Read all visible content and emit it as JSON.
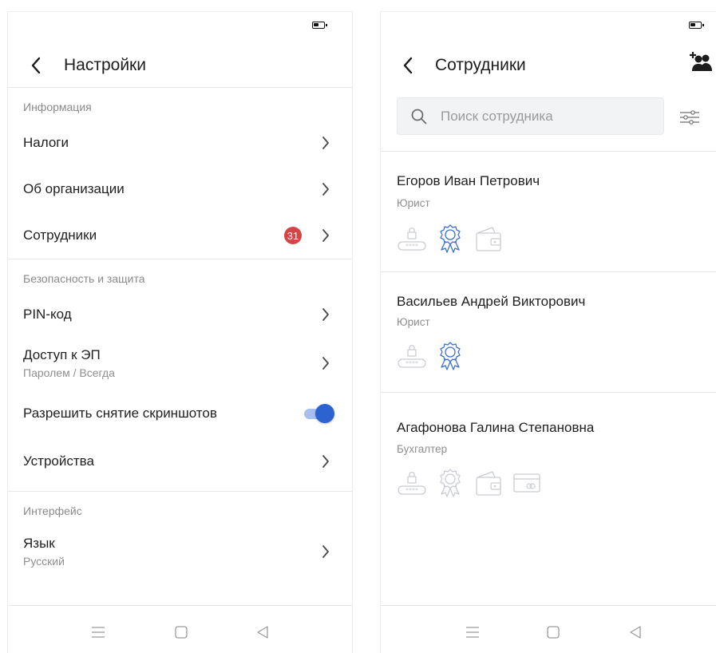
{
  "settings_screen": {
    "title": "Настройки",
    "sections": [
      {
        "header": "Информация",
        "items": [
          {
            "label": "Налоги"
          },
          {
            "label": "Об организации"
          },
          {
            "label": "Сотрудники",
            "badge": "31"
          }
        ]
      },
      {
        "header": "Безопасность и защита",
        "items": [
          {
            "label": "PIN-код"
          },
          {
            "label": "Доступ к ЭП",
            "sub": "Паролем / Всегда"
          },
          {
            "label": "Разрешить снятие скриншотов",
            "toggle": true
          },
          {
            "label": "Устройства"
          }
        ]
      },
      {
        "header": "Интерфейс",
        "items": [
          {
            "label": "Язык",
            "sub": "Русский"
          }
        ]
      }
    ]
  },
  "employees_screen": {
    "title": "Сотрудники",
    "search_placeholder": "Поиск сотрудника",
    "employees": [
      {
        "name": "Егоров Иван Петрович",
        "role": "Юрист",
        "icons": [
          "pin-lock-icon",
          "certificate-icon",
          "wallet-icon"
        ]
      },
      {
        "name": "Васильев Андрей Викторович",
        "role": "Юрист",
        "icons": [
          "pin-lock-icon",
          "certificate-icon"
        ]
      },
      {
        "name": "Агафонова Галина Степановна",
        "role": "Бухгалтер",
        "icons": [
          "pin-lock-icon",
          "certificate-icon",
          "wallet-icon",
          "card-icon"
        ]
      }
    ]
  },
  "colors": {
    "accent": "#2d62d1",
    "badge": "#d64545",
    "icon_active": "#3d6fd6",
    "icon_inactive": "#c9ccd2"
  }
}
